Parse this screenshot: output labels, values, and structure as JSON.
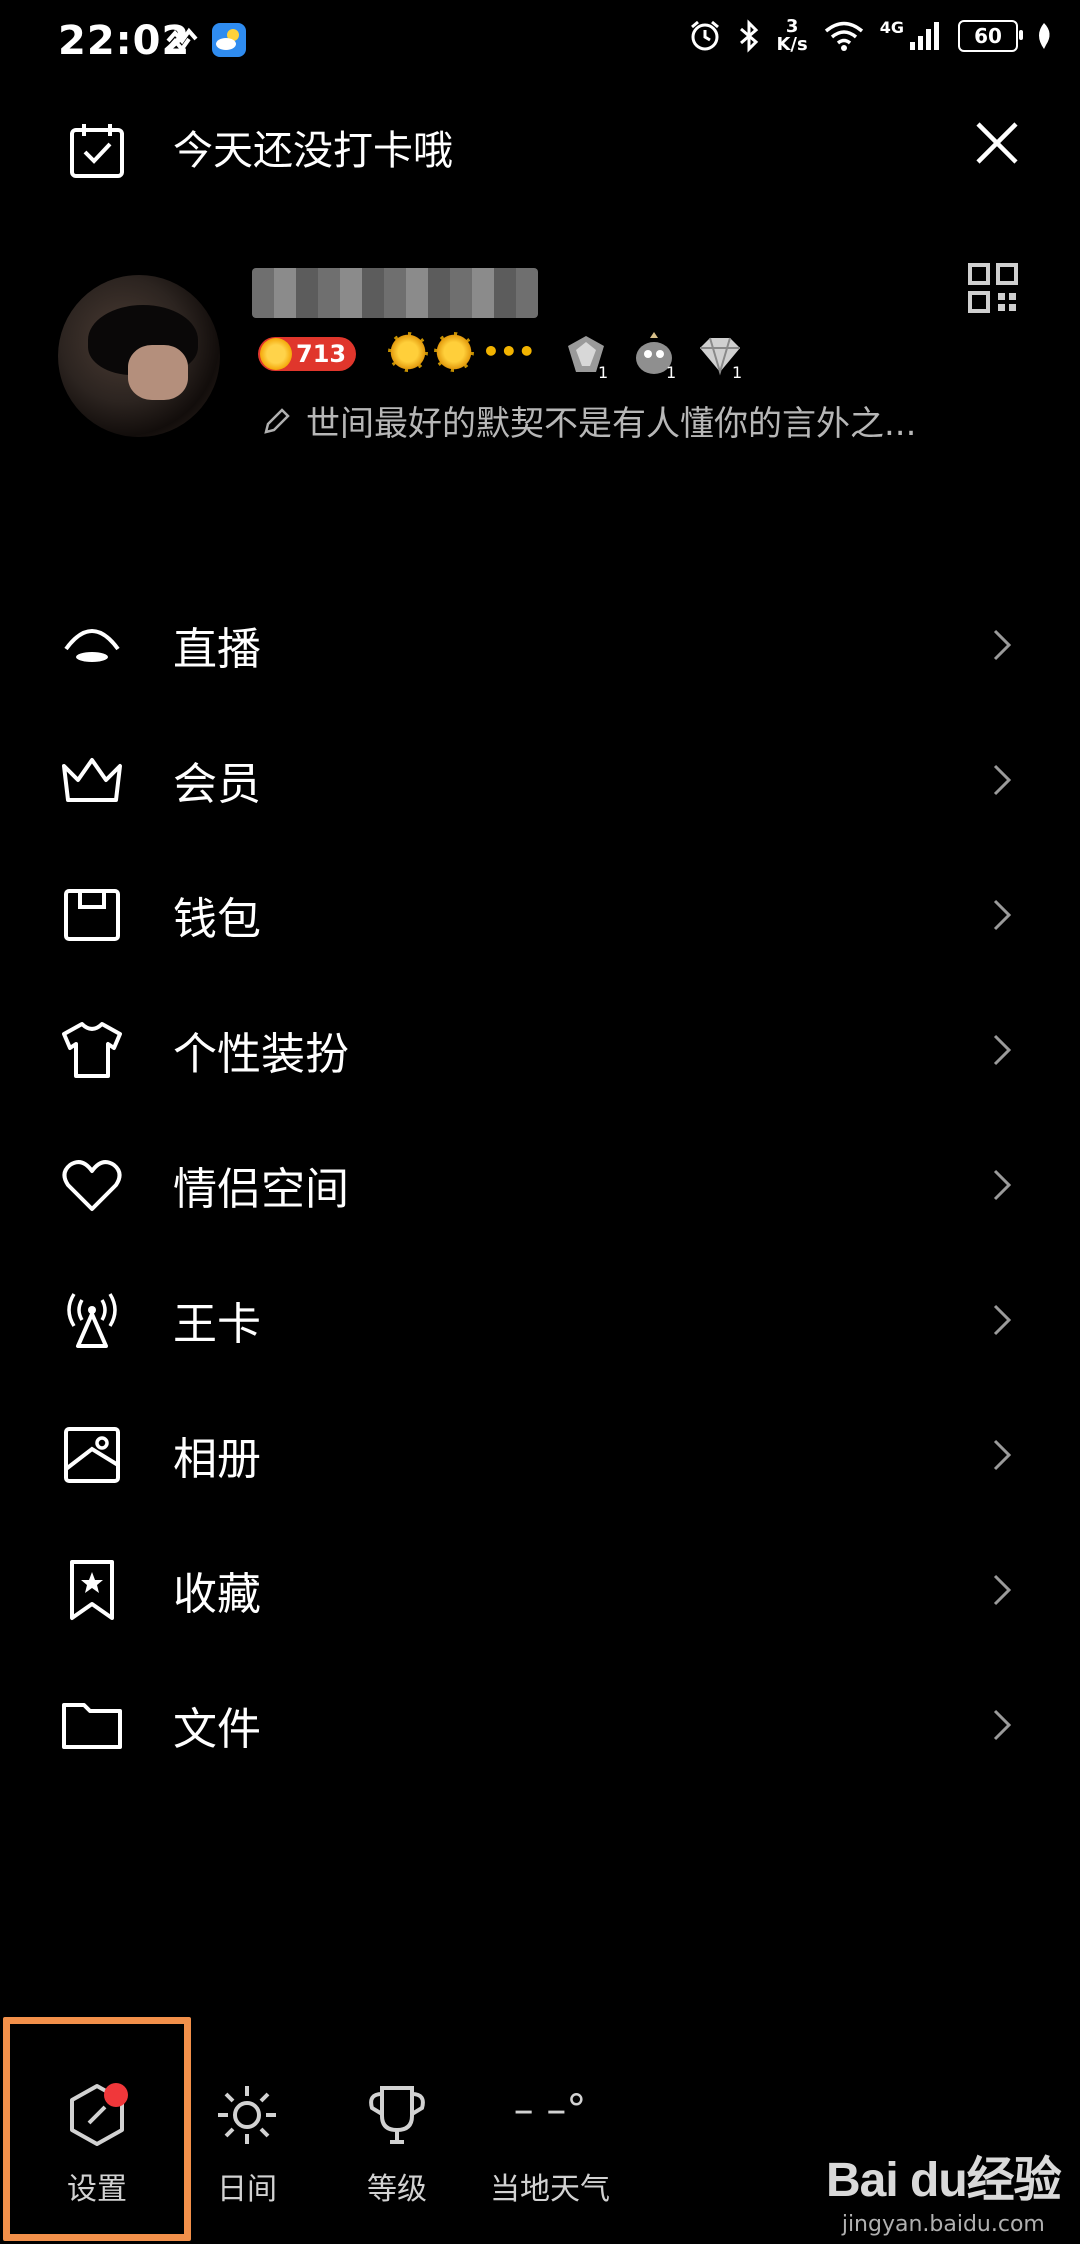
{
  "status_bar": {
    "time": "22:02",
    "net_speed_value": "3",
    "net_speed_unit": "K/s",
    "network_type": "4G",
    "battery": "60"
  },
  "checkin": {
    "text": "今天还没打卡哦",
    "icon": "calendar-check-icon"
  },
  "profile": {
    "coin_count": "713",
    "signature": "世间最好的默契不是有人懂你的言外之..."
  },
  "menu": [
    {
      "label": "直播",
      "icon": "live-icon"
    },
    {
      "label": "会员",
      "icon": "crown-icon"
    },
    {
      "label": "钱包",
      "icon": "wallet-icon"
    },
    {
      "label": "个性装扮",
      "icon": "tshirt-icon"
    },
    {
      "label": "情侣空间",
      "icon": "heart-icon"
    },
    {
      "label": "王卡",
      "icon": "signal-tower-icon"
    },
    {
      "label": "相册",
      "icon": "album-icon"
    },
    {
      "label": "收藏",
      "icon": "bookmark-icon"
    },
    {
      "label": "文件",
      "icon": "folder-icon"
    }
  ],
  "bottom_bar": {
    "settings": "设置",
    "day_mode": "日间",
    "level": "等级",
    "weather": "当地天气",
    "weather_value": "– –°"
  },
  "watermark": {
    "brand": "Bai du经验",
    "url": "jingyan.baidu.com"
  },
  "colors": {
    "highlight": "#f2904a",
    "coin_badge": "#e0362c",
    "notification_dot": "#f0373a"
  }
}
